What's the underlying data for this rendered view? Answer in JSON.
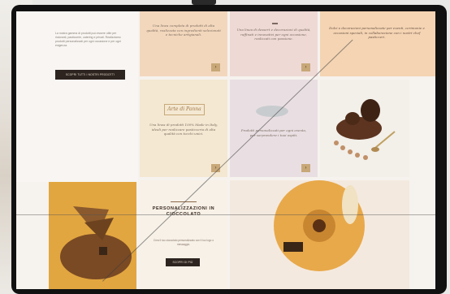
{
  "intro": {
    "text": "La nostra gamma di prodotti può essere utile per ristoranti, pasticcerie, catering e privati. Realizziamo prodotti personalizzati per ogni occasione e per ogni esigenza.",
    "button_label": "SCOPRI TUTTI I NOSTRI PRODOTTI"
  },
  "tiles": {
    "top1_text": "Una linea completa di prodotti di alta qualità, realizzata con ingredienti selezionati e tecniche artigianali.",
    "top2_text": "Una linea di dessert e decorazioni di qualità, raffinati e innovativi per ogni occasione, realizzati con passione.",
    "top3_text": "Dolci e decorazioni personalizzate per eventi, cerimonie e occasioni speciali, in collaborazione con i nostri chef pasticceri.",
    "mid1_logo": "Arte di Panna",
    "mid1_text": "Una linea di prodotti 100% Made in Italy, ideali per realizzare pasticceria di alta qualità con tocchi unici.",
    "mid2_text": "Prodotti personalizzati per ogni evento, per sorprendere i tuoi ospiti.",
    "personal_title": "PERSONALIZZAZIONI IN CIOCCOLATO",
    "personal_text": "Crea il tuo cioccolato personalizzato con il tuo logo o messaggio.",
    "personal_button": "SCOPRI DI PIÙ",
    "arrow_glyph": "›"
  },
  "colors": {
    "peach": "#f2d7bd",
    "pink": "#eed9d5",
    "cream": "#f4e8d2",
    "caramel": "#e8a94a"
  }
}
